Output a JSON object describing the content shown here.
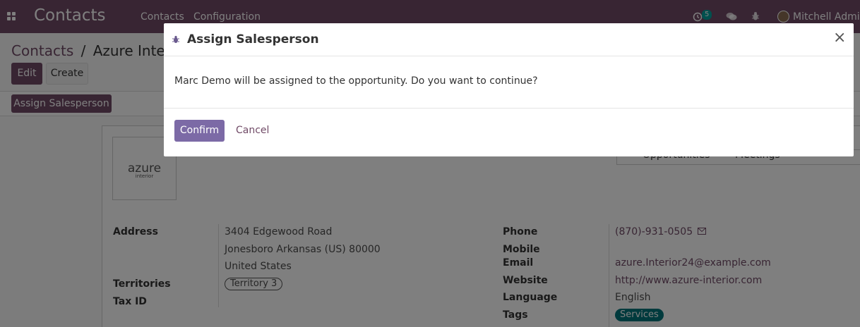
{
  "navbar": {
    "app_name": "Contacts",
    "menu": [
      "Contacts",
      "Configuration"
    ],
    "activity_count": "5",
    "user_name": "Mitchell Admin"
  },
  "control_panel": {
    "breadcrumb_root": "Contacts",
    "breadcrumb_separator": "/",
    "breadcrumb_current": "Azure Interior",
    "edit_label": "Edit",
    "create_label": "Create",
    "assign_label": "Assign Salesperson"
  },
  "form": {
    "logo_text": "azure",
    "logo_subtext": "interior",
    "smart_buttons": [
      "Opportunities",
      "Meetings"
    ],
    "left_fields": {
      "address_label": "Address",
      "address_line1": "3404 Edgewood Road",
      "address_line2": "Jonesboro  Arkansas (US)  80000",
      "address_line3": "United States",
      "territories_label": "Territories",
      "territory_tag": "Territory 3",
      "tax_id_label": "Tax ID"
    },
    "right_fields": {
      "phone_label": "Phone",
      "phone_value": "(870)-931-0505",
      "mobile_label": "Mobile",
      "email_label": "Email",
      "email_value": "azure.Interior24@example.com",
      "website_label": "Website",
      "website_value": "http://www.azure-interior.com",
      "language_label": "Language",
      "language_value": "English",
      "tags_label": "Tags",
      "tag_value": "Services"
    }
  },
  "modal": {
    "title": "Assign Salesperson",
    "message": "Marc Demo will be assigned to the opportunity. Do you want to continue?",
    "confirm_label": "Confirm",
    "cancel_label": "Cancel",
    "close_glyph": "×"
  },
  "colors": {
    "brand": "#714b67",
    "confirm": "#7c6aa6",
    "tag": "#00747a",
    "badge": "#00a09d"
  }
}
